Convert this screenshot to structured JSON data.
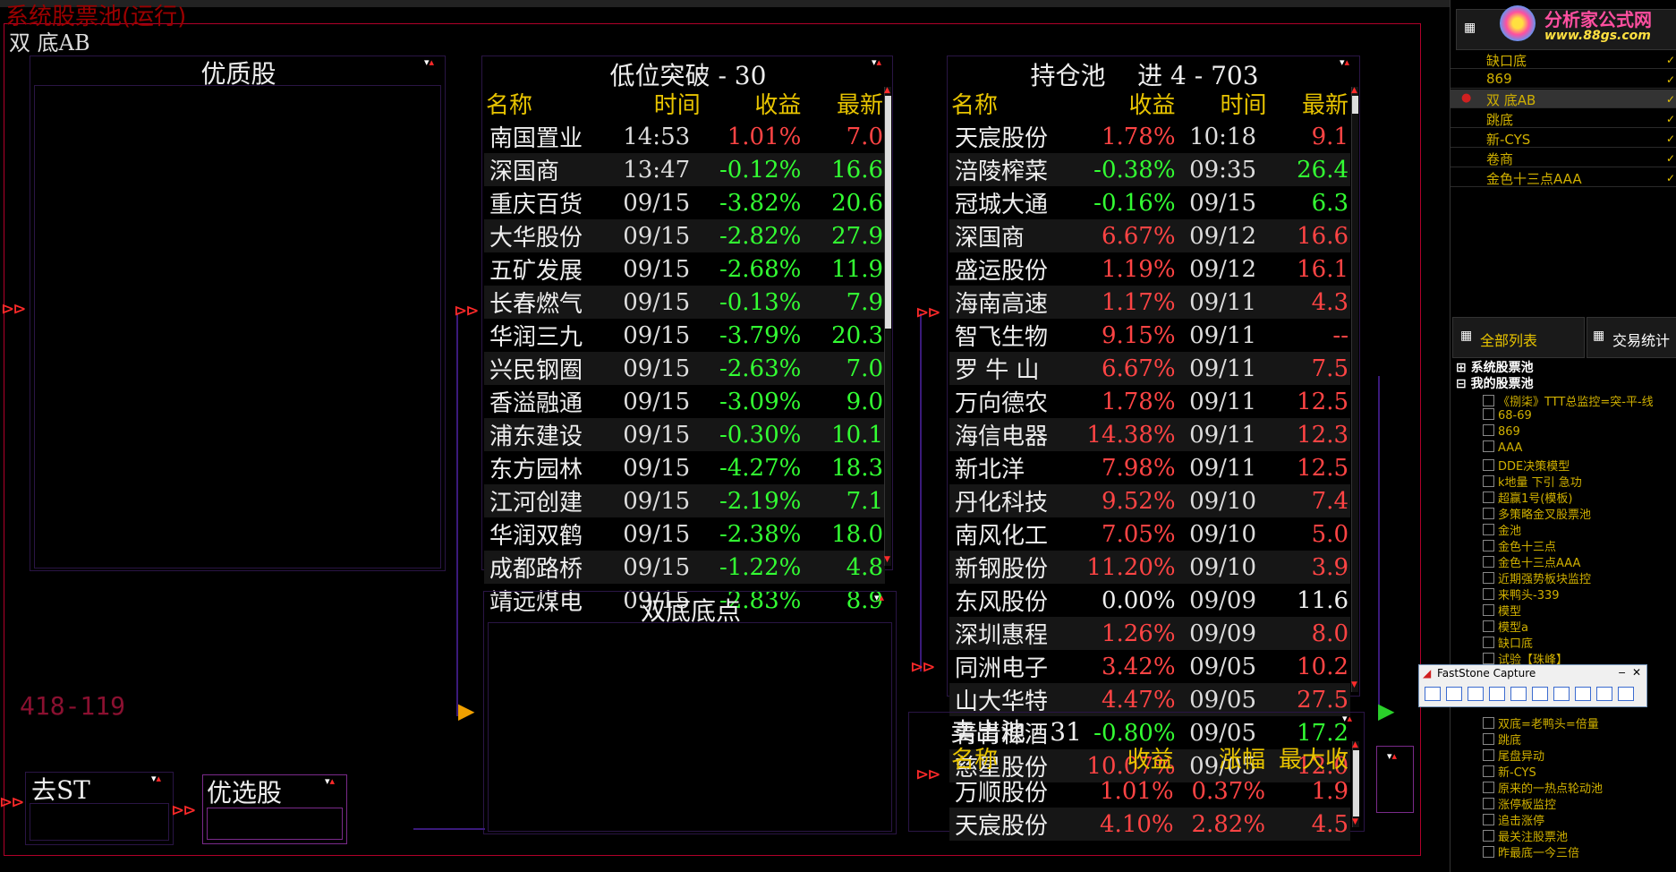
{
  "window": {
    "title": "系统股票池(运行)",
    "strategy_name": "双 底AB",
    "counter": "418-119"
  },
  "panels": {
    "quality": {
      "title": "优质股"
    },
    "low_break": {
      "title": "低位突破 - 30",
      "headers": [
        "名称",
        "时间",
        "收益",
        "最新"
      ],
      "rows": [
        [
          "南国置业",
          "14:53",
          "1.01%",
          "7.0",
          "red"
        ],
        [
          "深国商",
          "13:47",
          "-0.12%",
          "16.6",
          "green"
        ],
        [
          "重庆百货",
          "09/15",
          "-3.82%",
          "20.6",
          "green"
        ],
        [
          "大华股份",
          "09/15",
          "-2.82%",
          "27.9",
          "green"
        ],
        [
          "五矿发展",
          "09/15",
          "-2.68%",
          "11.9",
          "green"
        ],
        [
          "长春燃气",
          "09/15",
          "-0.13%",
          "7.9",
          "green"
        ],
        [
          "华润三九",
          "09/15",
          "-3.79%",
          "20.3",
          "green"
        ],
        [
          "兴民钢圈",
          "09/15",
          "-2.63%",
          "7.0",
          "green"
        ],
        [
          "香溢融通",
          "09/15",
          "-3.09%",
          "9.0",
          "green"
        ],
        [
          "浦东建设",
          "09/15",
          "-0.30%",
          "10.1",
          "green"
        ],
        [
          "东方园林",
          "09/15",
          "-4.27%",
          "18.3",
          "green"
        ],
        [
          "江河创建",
          "09/15",
          "-2.19%",
          "7.1",
          "green"
        ],
        [
          "华润双鹤",
          "09/15",
          "-2.38%",
          "18.0",
          "green"
        ],
        [
          "成都路桥",
          "09/15",
          "-1.22%",
          "4.8",
          "green"
        ],
        [
          "靖远煤电",
          "09/15",
          "-2.83%",
          "8.9",
          "green"
        ]
      ]
    },
    "holding": {
      "title": "持仓池    进 4 - 703",
      "headers": [
        "名称",
        "收益",
        "时间",
        "最新"
      ],
      "rows": [
        [
          "天宸股份",
          "1.78%",
          "10:18",
          "9.1",
          "red"
        ],
        [
          "涪陵榨菜",
          "-0.38%",
          "09:35",
          "26.4",
          "green"
        ],
        [
          "冠城大通",
          "-0.16%",
          "09/15",
          "6.3",
          "green"
        ],
        [
          "深国商",
          "6.67%",
          "09/12",
          "16.6",
          "red"
        ],
        [
          "盛运股份",
          "1.19%",
          "09/12",
          "16.1",
          "red"
        ],
        [
          "海南高速",
          "1.17%",
          "09/11",
          "4.3",
          "red"
        ],
        [
          "智飞生物",
          "9.15%",
          "09/11",
          "--",
          "red"
        ],
        [
          "罗 牛 山",
          "6.67%",
          "09/11",
          "7.5",
          "red"
        ],
        [
          "万向德农",
          "1.78%",
          "09/11",
          "12.5",
          "red"
        ],
        [
          "海信电器",
          "14.38%",
          "09/11",
          "12.3",
          "red"
        ],
        [
          "新北洋",
          "7.98%",
          "09/11",
          "12.5",
          "red"
        ],
        [
          "丹化科技",
          "9.52%",
          "09/10",
          "7.4",
          "red"
        ],
        [
          "南风化工",
          "7.05%",
          "09/10",
          "5.0",
          "red"
        ],
        [
          "新钢股份",
          "11.20%",
          "09/10",
          "3.9",
          "red"
        ],
        [
          "东风股份",
          "0.00%",
          "09/09",
          "11.6",
          "white"
        ],
        [
          "深圳惠程",
          "1.26%",
          "09/09",
          "8.0",
          "red"
        ],
        [
          "同洲电子",
          "3.42%",
          "09/05",
          "10.2",
          "red"
        ],
        [
          "山大华特",
          "4.47%",
          "09/05",
          "27.5",
          "red"
        ],
        [
          "青青稞酒",
          "-0.80%",
          "09/05",
          "17.2",
          "green"
        ],
        [
          "慈星股份",
          "10.07%",
          "09/05",
          "12.0",
          "red"
        ]
      ]
    },
    "double_bottom": {
      "title": "双底底点"
    },
    "sell": {
      "title": "卖出池 - 31",
      "headers": [
        "名称",
        "收益",
        "涨幅",
        "最大收"
      ],
      "rows": [
        [
          "万顺股份",
          "1.01%",
          "0.37%",
          "1.9",
          "red"
        ],
        [
          "天宸股份",
          "4.10%",
          "2.82%",
          "4.5",
          "red"
        ]
      ]
    },
    "remove_st": {
      "title": "去ST"
    },
    "selected": {
      "title": "优选股"
    }
  },
  "sidebar": {
    "logo_text": "分析家公式网",
    "logo_url_text": "www.88gs.com",
    "pool_items": [
      "缺口底",
      "869",
      "双 底AB",
      "跳底",
      "新-CYS",
      "卷商",
      "金色十三点AAA"
    ],
    "active_index": 2,
    "tabs": [
      "全部列表",
      "交易统计"
    ],
    "tree_system": "系统股票池",
    "tree_mine": "我的股票池",
    "tree_items_top": [
      "《捌柒》TTT总监控=突-平-线",
      "68-69",
      "869",
      "AAA",
      "DDE决策模型",
      "k地量 下引 急功",
      "超赢1号(模板)",
      "多策略金叉股票池",
      "金池",
      "金色十三点",
      "金色十三点AAA",
      "近期强势板块监控",
      "来鸭头-339",
      "模型",
      "模型a",
      "缺口底",
      "试验【珠峰】"
    ],
    "tree_items_bottom": [
      "双底=老鸭头=倍量",
      "跳底",
      "尾盘异动",
      "新-CYS",
      "原来的一热点轮动池",
      "涨停板监控",
      "追击涨停",
      "最关注股票池",
      "昨最底一今三倍"
    ]
  },
  "faststone": {
    "title": "FastStone Capture"
  }
}
